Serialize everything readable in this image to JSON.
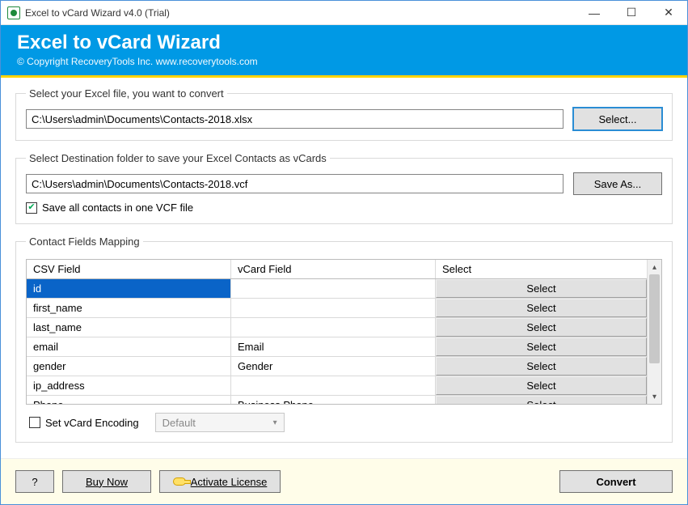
{
  "window": {
    "title": "Excel to vCard Wizard v4.0 (Trial)"
  },
  "banner": {
    "heading": "Excel to vCard Wizard",
    "copyright": "© Copyright RecoveryTools Inc. www.recoverytools.com"
  },
  "source": {
    "legend": "Select your Excel file, you want to convert",
    "path": "C:\\Users\\admin\\Documents\\Contacts-2018.xlsx",
    "select_label": "Select..."
  },
  "destination": {
    "legend": "Select Destination folder to save your Excel Contacts as vCards",
    "path": "C:\\Users\\admin\\Documents\\Contacts-2018.vcf",
    "saveas_label": "Save As...",
    "one_vcf_label": "Save all contacts in one VCF file",
    "one_vcf_checked": true
  },
  "mapping": {
    "legend": "Contact Fields Mapping",
    "headers": {
      "csv": "CSV Field",
      "vcard": "vCard Field",
      "select": "Select"
    },
    "select_button": "Select",
    "rows": [
      {
        "csv": "id",
        "vcard": "",
        "selected": true
      },
      {
        "csv": "first_name",
        "vcard": "",
        "selected": false
      },
      {
        "csv": "last_name",
        "vcard": "",
        "selected": false
      },
      {
        "csv": "email",
        "vcard": "Email",
        "selected": false
      },
      {
        "csv": "gender",
        "vcard": "Gender",
        "selected": false
      },
      {
        "csv": "ip_address",
        "vcard": "",
        "selected": false
      },
      {
        "csv": "Phone",
        "vcard": "Business Phone",
        "selected": false
      }
    ]
  },
  "encoding": {
    "label": "Set vCard Encoding",
    "value": "Default",
    "checked": false
  },
  "bottom": {
    "help": "?",
    "buy": "Buy Now",
    "activate": "Activate License",
    "convert": "Convert"
  }
}
